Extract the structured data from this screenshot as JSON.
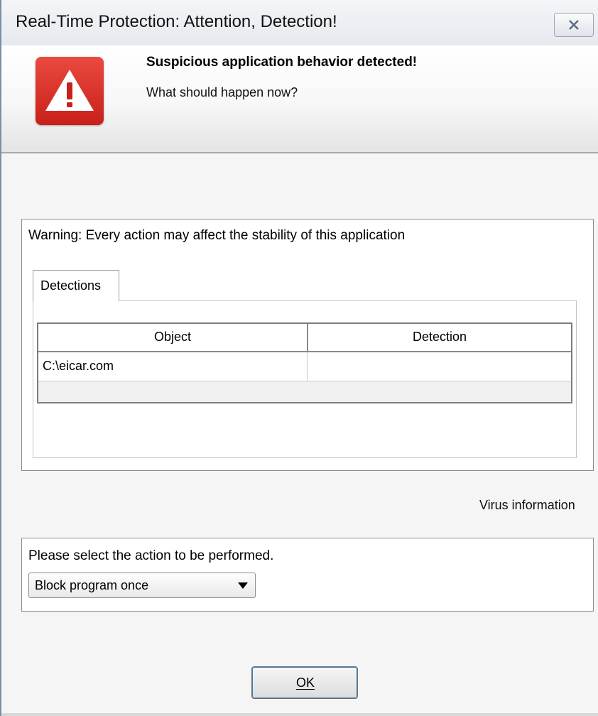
{
  "window": {
    "title": "Real-Time Protection: Attention, Detection!"
  },
  "header": {
    "headline": "Suspicious application behavior detected!",
    "subline": "What should happen now?",
    "icon": "warning-triangle-icon",
    "accent_color": "#d42a22"
  },
  "detections_panel": {
    "warning": "Warning: Every action may affect the stability of this application",
    "tab_label": "Detections",
    "columns": [
      "Object",
      "Detection"
    ],
    "rows": [
      {
        "object": "C:\\eicar.com",
        "detection": ""
      }
    ]
  },
  "links": {
    "virus_information": "Virus information"
  },
  "action": {
    "label": "Please select the action to be performed.",
    "selected": "Block program once"
  },
  "buttons": {
    "ok": "OK"
  }
}
